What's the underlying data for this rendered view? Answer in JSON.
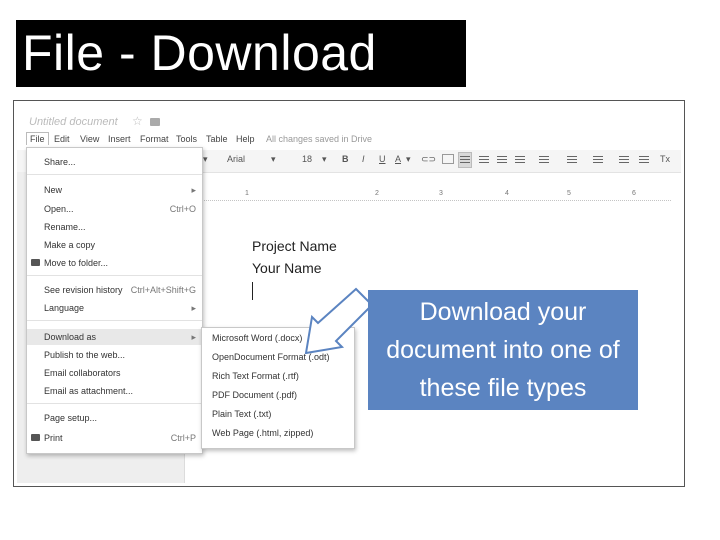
{
  "slide": {
    "title": "File - Download",
    "callout_text": "Download your document into one of these file types"
  },
  "docs": {
    "doc_title": "Untitled document",
    "star_icon": "star-icon",
    "folder_icon": "folder-icon",
    "menubar": {
      "file": "File",
      "edit": "Edit",
      "view": "View",
      "insert": "Insert",
      "format": "Format",
      "tools": "Tools",
      "table": "Table",
      "help": "Help",
      "saved_status": "All changes saved in Drive"
    },
    "toolbar": {
      "font": "Arial",
      "size": "18",
      "bold": "B",
      "italic": "I",
      "underline": "U",
      "text_color": "A",
      "clear_formatting": "Tx"
    },
    "ruler_ticks": [
      "1",
      "2",
      "3",
      "4",
      "5",
      "6"
    ],
    "body": {
      "line1": "Project Name",
      "line2": "Your Name"
    },
    "file_menu": {
      "share": "Share...",
      "new": "New",
      "open": "Open...",
      "open_shortcut": "Ctrl+O",
      "rename": "Rename...",
      "make_copy": "Make a copy",
      "move_to_folder": "Move to folder...",
      "revision_history": "See revision history",
      "revision_shortcut": "Ctrl+Alt+Shift+G",
      "language": "Language",
      "download_as": "Download as",
      "publish": "Publish to the web...",
      "email_collaborators": "Email collaborators",
      "email_attachment": "Email as attachment...",
      "page_setup": "Page setup...",
      "print": "Print",
      "print_shortcut": "Ctrl+P"
    },
    "download_submenu": {
      "docx": "Microsoft Word (.docx)",
      "odt": "OpenDocument Format (.odt)",
      "rtf": "Rich Text Format (.rtf)",
      "pdf": "PDF Document (.pdf)",
      "txt": "Plain Text (.txt)",
      "html": "Web Page (.html, zipped)"
    }
  },
  "colors": {
    "title_bg": "#000000",
    "callout_bg": "#5b84c1",
    "arrow_stroke": "#5b84c1"
  }
}
